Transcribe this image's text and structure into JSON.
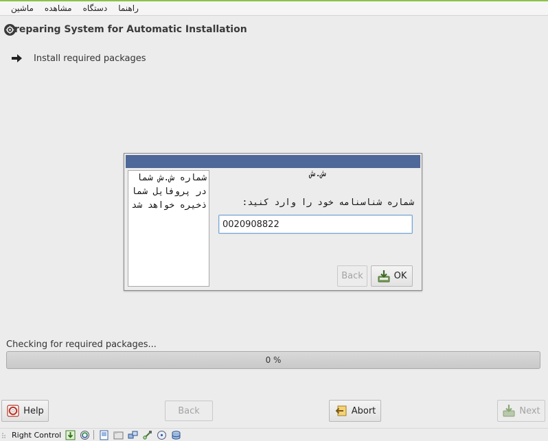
{
  "menubar": {
    "items": [
      "ماشین",
      "مشاهده",
      "دستگاه",
      "راهنما"
    ]
  },
  "header": {
    "title": "reparing System for Automatic Installation"
  },
  "steps": [
    {
      "label": "Install required packages",
      "state": "current"
    }
  ],
  "dialog": {
    "heading": "ش.ش",
    "side_text": "شماره ش.ش شما در پروفایل شما ذخیره خواهد شد",
    "prompt": "شماره شناسنامه خود را وارد کنید:",
    "input_value": "0020908822",
    "back_label": "Back",
    "ok_label": "OK"
  },
  "progress": {
    "label": "Checking for required packages...",
    "text": "0 %",
    "value": 0
  },
  "nav": {
    "help_label": "Help",
    "back_label": "Back",
    "abort_label": "Abort",
    "next_label": "Next"
  },
  "statusbar": {
    "host_key": "Right Control",
    "icons": [
      "keyboard-capture-icon",
      "mouse-integration-icon",
      "display-icon",
      "shared-folder-icon",
      "network-icon",
      "usb-icon",
      "optical-drive-icon",
      "hard-disk-icon"
    ]
  },
  "colors": {
    "dialog_titlebar": "#4e6899",
    "accent": "#8bc34a",
    "input_border": "#7aa6d6"
  }
}
